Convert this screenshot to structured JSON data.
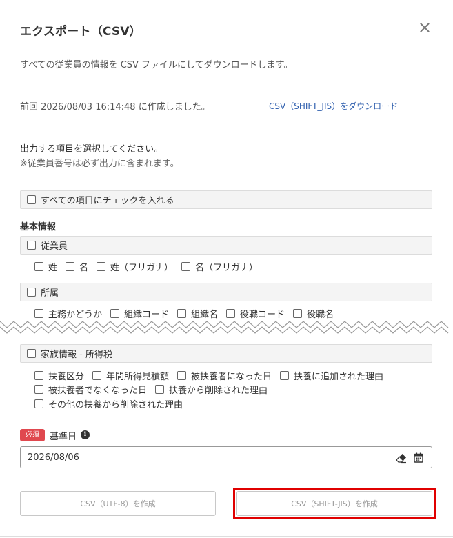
{
  "dialog": {
    "title": "エクスポート（CSV）",
    "description": "すべての従業員の情報を CSV ファイルにしてダウンロードします。",
    "last_created": "前回 2026/08/03 16:14:48 に作成しました。",
    "download_link": "CSV（SHIFT_JIS）をダウンロード",
    "instruction_1": "出力する項目を選択してください。",
    "instruction_2": "※従業員番号は必ず出力に含まれます。"
  },
  "select_all": {
    "label": "すべての項目にチェックを入れる",
    "checked": false
  },
  "basic_info": {
    "title": "基本情報",
    "employee": {
      "label": "従業員",
      "items": [
        "姓",
        "名",
        "姓（フリガナ）",
        "名（フリガナ）"
      ]
    },
    "affiliation": {
      "label": "所属",
      "items": [
        "主務かどうか",
        "組織コード",
        "組織名",
        "役職コード",
        "役職名"
      ]
    },
    "family": {
      "label": "家族情報 - 所得税",
      "items_row1": [
        "扶養区分",
        "年間所得見積額",
        "被扶養者になった日",
        "扶養に追加された理由"
      ],
      "items_row2": [
        "被扶養者でなくなった日",
        "扶養から削除された理由"
      ],
      "items_row3": [
        "その他の扶養から削除された理由"
      ]
    }
  },
  "base_date": {
    "required_badge": "必須",
    "label": "基準日",
    "value": "2026/08/06"
  },
  "buttons": {
    "utf8": "CSV（UTF-8）を作成",
    "sjis": "CSV（SHIFT-JIS）を作成"
  },
  "colors": {
    "link": "#2f5fae",
    "required": "#e0484f",
    "highlight": "#e00000"
  }
}
